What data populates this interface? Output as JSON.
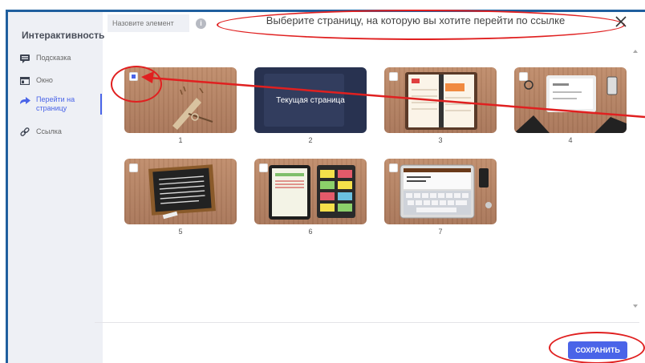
{
  "sidebar": {
    "title": "Интерактивность",
    "items": [
      {
        "label": "Подсказка",
        "icon": "tooltip-icon"
      },
      {
        "label": "Окно",
        "icon": "window-icon"
      },
      {
        "label": "Перейти на страницу",
        "icon": "arrow-right-icon",
        "active": true
      },
      {
        "label": "Ссылка",
        "icon": "link-icon"
      }
    ]
  },
  "header": {
    "search_placeholder": "Назовите элемент",
    "title": "Выберите страницу, на которую вы хотите перейти по ссылке"
  },
  "pages": [
    {
      "number": "1",
      "selected": true
    },
    {
      "number": "2",
      "current": true,
      "current_label": "Текущая страница"
    },
    {
      "number": "3"
    },
    {
      "number": "4"
    },
    {
      "number": "5"
    },
    {
      "number": "6"
    },
    {
      "number": "7"
    }
  ],
  "footer": {
    "save_label": "СОХРАНИТЬ"
  },
  "colors": {
    "accent": "#4a64e8",
    "annotation": "#e02020",
    "sidebar_bg": "#eef0f5",
    "frame": "#1f5f9e"
  }
}
